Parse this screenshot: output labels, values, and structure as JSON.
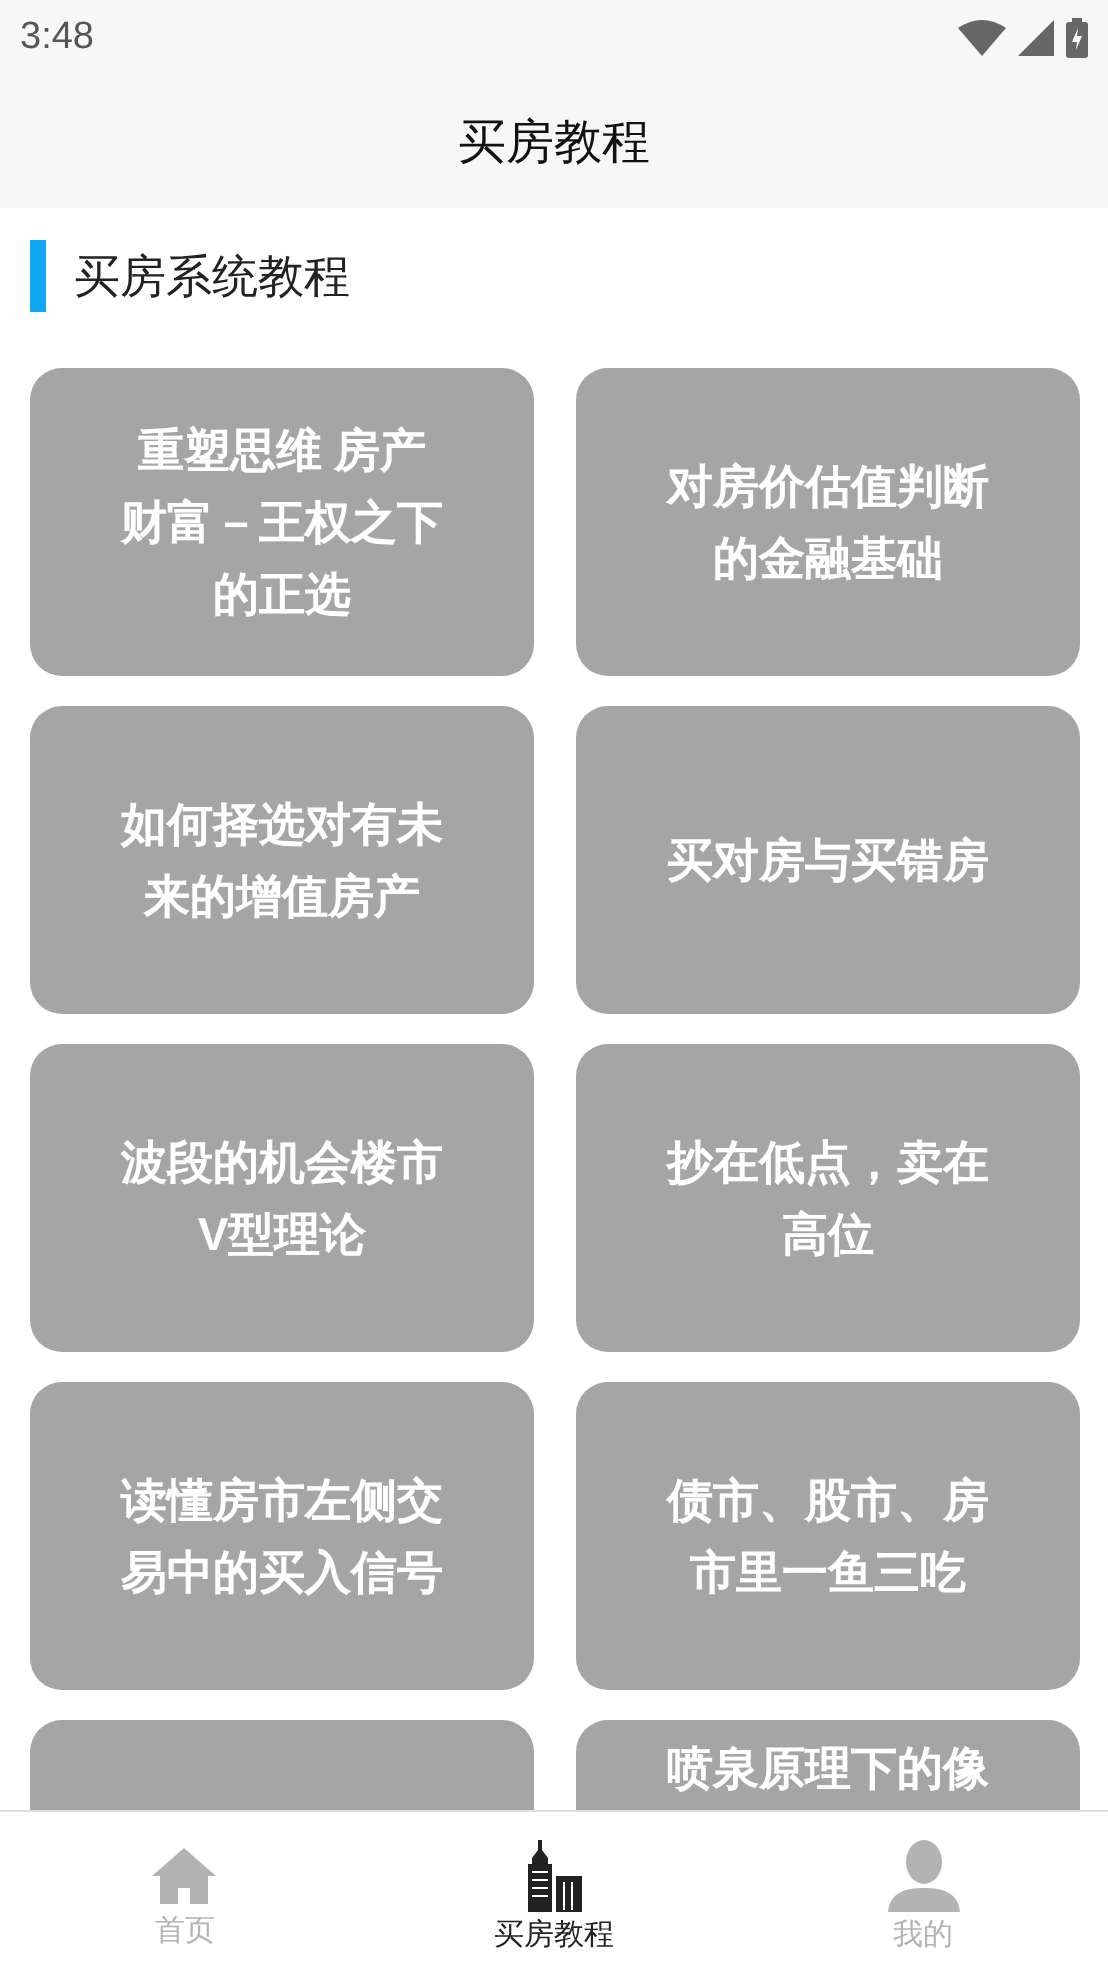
{
  "status_bar": {
    "time": "3:48"
  },
  "header": {
    "title": "买房教程"
  },
  "section": {
    "title": "买房系统教程"
  },
  "cards": [
    {
      "kind": "full",
      "title": "重塑思维 房产财富－王权之下的正选"
    },
    {
      "kind": "full",
      "title": "对房价估值判断的金融基础"
    },
    {
      "kind": "full",
      "title": "如何择选对有未来的增值房产"
    },
    {
      "kind": "full",
      "title": "买对房与买错房"
    },
    {
      "kind": "full",
      "title": "波段的机会楼市V型理论"
    },
    {
      "kind": "full",
      "title": "抄在低点，卖在高位"
    },
    {
      "kind": "full",
      "title": "读懂房市左侧交易中的买入信号"
    },
    {
      "kind": "full",
      "title": "债市、股市、房市里一鱼三吃"
    },
    {
      "kind": "cut"
    },
    {
      "kind": "cut",
      "title": "喷泉原理下的像"
    }
  ],
  "tabs": [
    {
      "label": "首页",
      "selected": false
    },
    {
      "label": "买房教程",
      "selected": true
    },
    {
      "label": "我的",
      "selected": false
    }
  ]
}
